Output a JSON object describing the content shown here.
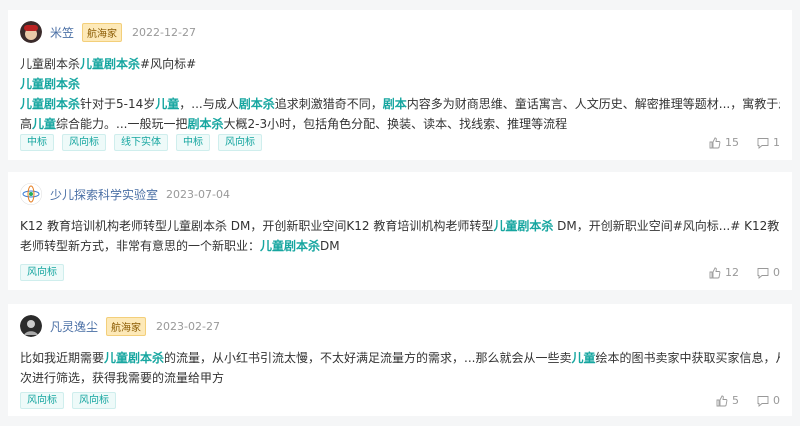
{
  "posts": [
    {
      "user": "米笠",
      "badge": "航海家",
      "date": "2022-12-27",
      "title_a": "儿童剧本杀",
      "title_b": "儿童剧本杀",
      "title_c": "#风向标#",
      "subtitle": "儿童剧本杀",
      "l3": {
        "a": "儿童剧本杀",
        "b": "针对于5-14岁",
        "c": "儿童",
        "d": "，...与成人",
        "e": "剧本杀",
        "f": "追求刺激猎奇不同，",
        "g": "剧本",
        "h": "内容多为财商思维、童话寓言、人文历史、解密推理等题材...，寓教于乐，可提"
      },
      "l4": {
        "a": "高",
        "b": "儿童",
        "c": "综合能力。...一般玩一把",
        "d": "剧本杀",
        "e": "大概2-3小时，包括角色分配、换装、读本、找线索、推理等流程"
      },
      "tags": [
        "中标",
        "风向标",
        "线下实体",
        "中标",
        "风向标"
      ],
      "likes": "15",
      "comments": "1"
    },
    {
      "user": "少儿探索科学实验室",
      "date": "2023-07-04",
      "l1": {
        "a": "K12 教育培训机构老师转型儿童剧本杀 DM，开创新职业空间K12 教育培训机构老师转型",
        "b": "儿童剧本杀",
        "c": " DM，开创新职业空间#风向标...# K12教育培训机构"
      },
      "l2": {
        "a": "老师转型新方式，非常有意思的一个新职业：",
        "b": "儿童剧本杀",
        "c": "DM"
      },
      "tags": [
        "风向标"
      ],
      "likes": "12",
      "comments": "0"
    },
    {
      "user": "凡灵逸尘",
      "badge": "航海家",
      "date": "2023-02-27",
      "l1": {
        "a": "比如我近期需要",
        "b": "儿童剧本杀",
        "c": "的流量，从小红书引流太慢，不太好满足流量方的需求，...那么就会从一些卖",
        "d": "儿童",
        "e": "绘本的图书卖家中获取买家信息，从而再"
      },
      "l2": "次进行筛选，获得我需要的流量给甲方",
      "tags": [
        "风向标",
        "风向标"
      ],
      "likes": "5",
      "comments": "0"
    }
  ]
}
